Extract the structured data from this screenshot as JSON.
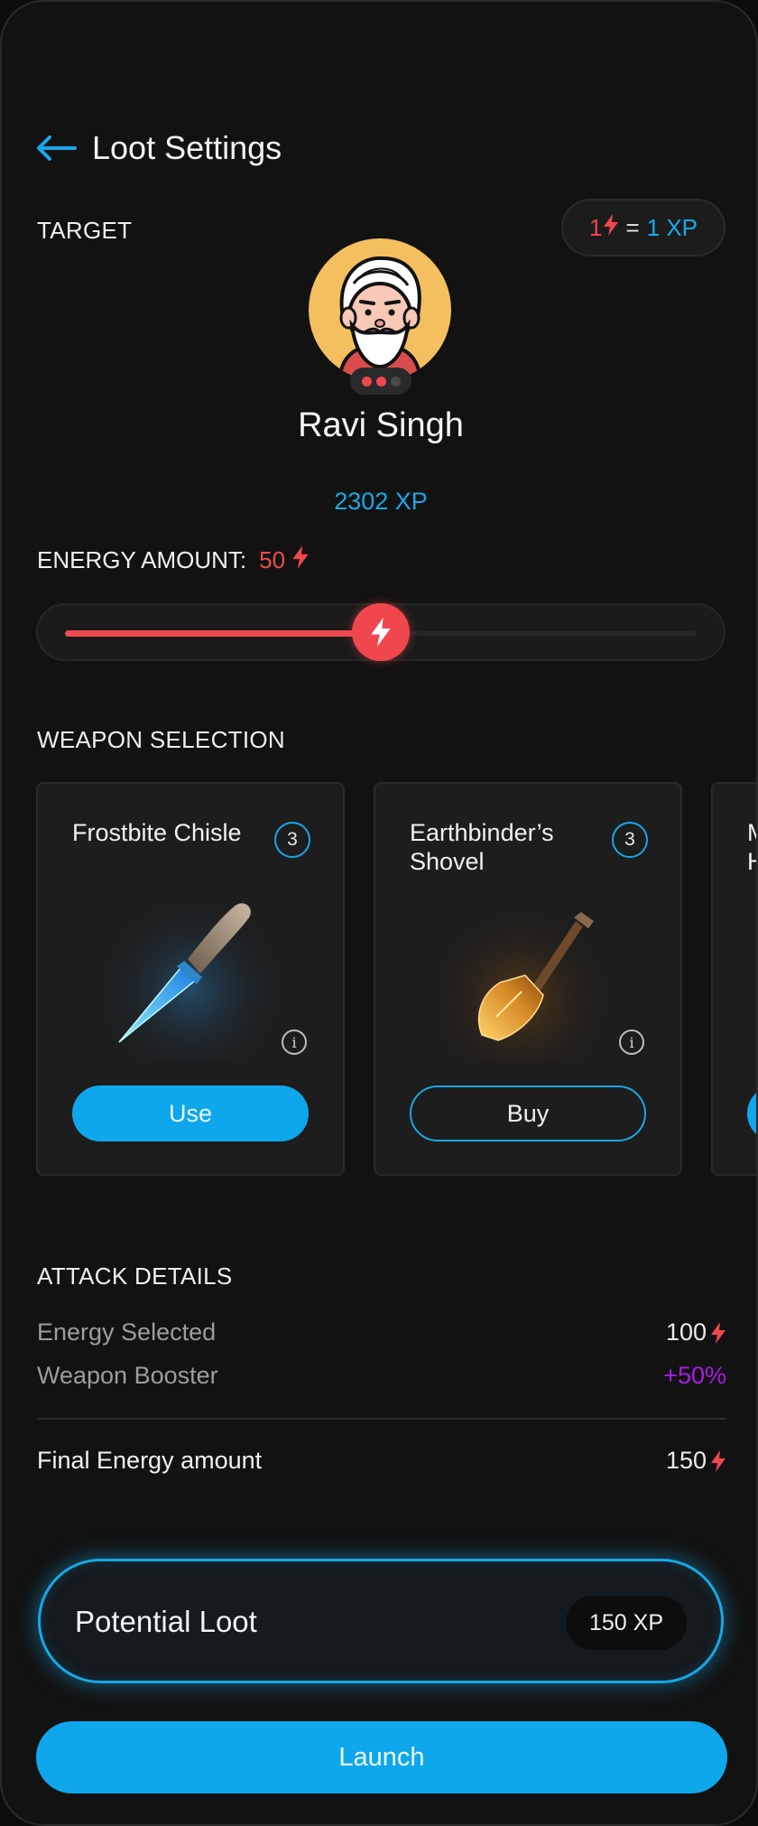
{
  "header": {
    "title": "Loot Settings"
  },
  "target": {
    "section_label": "TARGET",
    "rate": {
      "lhs": "1",
      "eq": "=",
      "rhs": "1 XP"
    },
    "name": "Ravi Singh",
    "xp": "2302 XP"
  },
  "energy": {
    "label": "ENERGY AMOUNT:",
    "value": "50",
    "slider_fraction": 0.5
  },
  "weapons": {
    "section_label": "WEAPON SELECTION",
    "items": [
      {
        "name": "Frostbite Chisle",
        "count": "3",
        "action": "Use"
      },
      {
        "name": "Earthbinder’s Shovel",
        "count": "3",
        "action": "Buy"
      },
      {
        "name": "M H",
        "count": "",
        "action": ""
      }
    ]
  },
  "attack": {
    "section_label": "ATTACK DETAILS",
    "energy_selected": {
      "label": "Energy Selected",
      "value": "100"
    },
    "weapon_booster": {
      "label": "Weapon Booster",
      "value": "+50%"
    },
    "final_energy": {
      "label": "Final Energy amount",
      "value": "150"
    }
  },
  "loot": {
    "label": "Potential Loot",
    "value": "150 XP"
  },
  "launch": {
    "label": "Launch"
  },
  "colors": {
    "accent_blue": "#19a7e8",
    "energy_red": "#f0464e",
    "booster_purple": "#a81ce5",
    "avatar_bg": "#f4bf5f"
  }
}
